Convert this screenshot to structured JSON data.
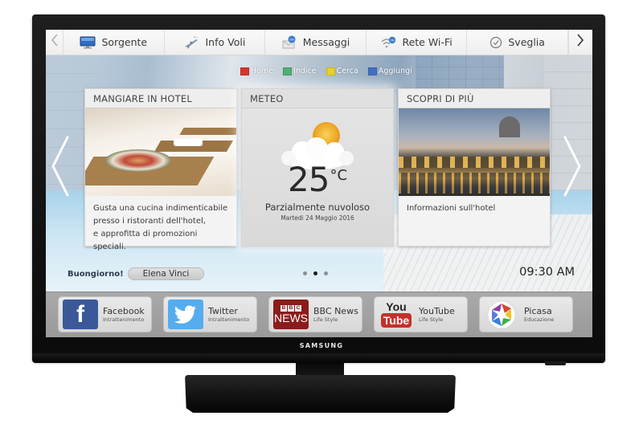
{
  "device": {
    "brand": "SAMSUNG"
  },
  "top_menu": {
    "items": [
      {
        "label": "Sorgente",
        "icon": "monitor-icon"
      },
      {
        "label": "Info Voli",
        "icon": "airplane-icon"
      },
      {
        "label": "Messaggi",
        "icon": "message-icon"
      },
      {
        "label": "Rete Wi-Fi",
        "icon": "wifi-icon"
      },
      {
        "label": "Sveglia",
        "icon": "clock-icon"
      }
    ],
    "prev_icon": "chevron-left-icon",
    "next_icon": "chevron-right-icon"
  },
  "color_keys": [
    {
      "label": "Home",
      "color": "#d9322d"
    },
    {
      "label": "Indice",
      "color": "#4fae72"
    },
    {
      "label": "Cerca",
      "color": "#e7d321"
    },
    {
      "label": "Aggiungi",
      "color": "#3f70c4"
    }
  ],
  "cards": {
    "left": {
      "title": "MANGIARE IN HOTEL",
      "text_lines": [
        "Gusta una cucina indimenticabile",
        "presso i ristoranti dell'hotel,",
        "e approfitta di promozioni speciali."
      ]
    },
    "center": {
      "title": "METEO",
      "temperature": "25",
      "unit": "°C",
      "condition": "Parzialmente nuvoloso",
      "date": "Martedi 24 Maggio 2016"
    },
    "right": {
      "title": "SCOPRI DI PIÙ",
      "text": "Informazioni sull'hotel"
    }
  },
  "carousel": {
    "page_count": 3,
    "active_page": 2
  },
  "greeting": {
    "text": "Buongiorno!",
    "user_name": "Elena Vinci"
  },
  "clock": "09:30 AM",
  "apps": [
    {
      "name": "Facebook",
      "category": "Intrattenimento",
      "icon": "facebook-icon",
      "color": "#3b5998"
    },
    {
      "name": "Twitter",
      "category": "Intrattenimento",
      "icon": "twitter-icon",
      "color": "#55acee"
    },
    {
      "name": "BBC News",
      "category": "Life Style",
      "icon": "bbc-news-icon",
      "color": "#8a1c1c"
    },
    {
      "name": "YouTube",
      "category": "Life Style",
      "icon": "youtube-icon",
      "color": "#c4302b"
    },
    {
      "name": "Picasa",
      "category": "Educazione",
      "icon": "picasa-icon"
    }
  ],
  "icon_text": {
    "facebook": "f",
    "bbc_blocks": [
      "B",
      "B",
      "C"
    ],
    "bbc_news": "NEWS",
    "youtube_you": "You",
    "youtube_tube": "Tube"
  }
}
